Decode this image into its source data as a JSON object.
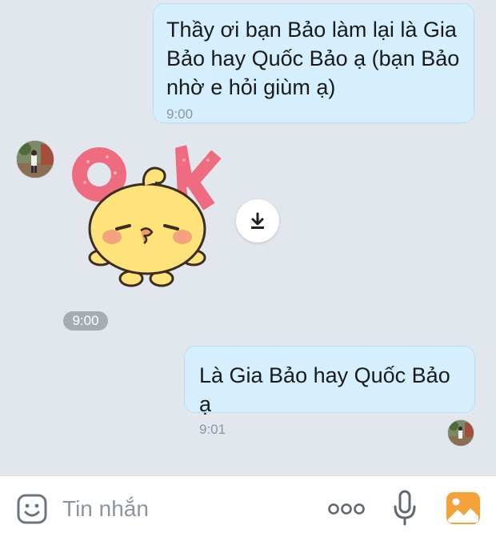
{
  "messages": [
    {
      "id": "msg1",
      "direction": "outgoing",
      "lines": [
        "Thầy ơi bạn Bảo làm lại là Gia",
        "Bảo hay Quốc Bảo ạ (bạn Bảo",
        "nhờ e hỏi giùm ạ)"
      ],
      "time": "9:00"
    },
    {
      "id": "msg2",
      "direction": "incoming",
      "type": "sticker",
      "sticker": "ok-chick-sticker",
      "time": "9:00"
    },
    {
      "id": "msg3",
      "direction": "outgoing",
      "text": "Là Gia Bảo hay Quốc Bảo ạ",
      "time": "9:01"
    }
  ],
  "composer": {
    "placeholder": "Tin nhắn",
    "icons": [
      "emoji-icon",
      "more-icon",
      "microphone-icon",
      "image-icon"
    ]
  },
  "colors": {
    "chat_background": "#e2e7ee",
    "outgoing_bubble": "#d5effe",
    "timestamp_pill": "#a4acb4",
    "image_icon": "#f5a23a"
  }
}
